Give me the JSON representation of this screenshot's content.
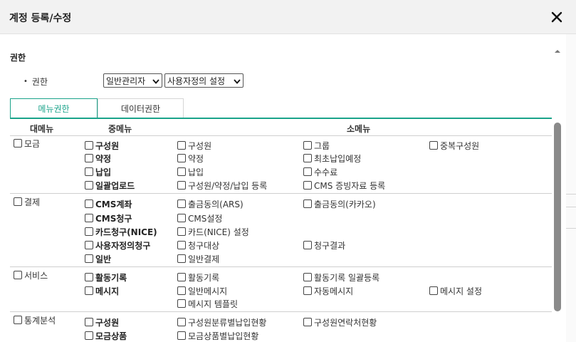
{
  "dialog": {
    "title": "계정 등록/수정"
  },
  "section": {
    "title": "권한"
  },
  "permission": {
    "label": "권한",
    "role_value": "일반관리자",
    "perm_value": "사용자정의 설정"
  },
  "tabs": [
    {
      "label": "메뉴권한",
      "active": true
    },
    {
      "label": "데이터권한",
      "active": false
    }
  ],
  "table": {
    "headers": {
      "main": "대메뉴",
      "mid": "중메뉴",
      "sub": "소메뉴"
    },
    "groups": [
      {
        "main": "모금",
        "rows": [
          {
            "mid": "구성원",
            "subs": [
              "구성원",
              "그룹",
              "중복구성원"
            ]
          },
          {
            "mid": "약정",
            "subs": [
              "약정",
              "최초납입예정"
            ]
          },
          {
            "mid": "납입",
            "subs": [
              "납입",
              "수수료"
            ]
          },
          {
            "mid": "일괄업로드",
            "subs": [
              "구성원/약정/납입 등록",
              "CMS 증빙자료 등록"
            ]
          }
        ]
      },
      {
        "main": "결제",
        "rows": [
          {
            "mid": "CMS계좌",
            "subs": [
              "출금동의(ARS)",
              "출금동의(카카오)"
            ]
          },
          {
            "mid": "CMS청구",
            "subs": [
              "CMS설정"
            ]
          },
          {
            "mid": "카드청구(NICE)",
            "subs": [
              "카드(NICE) 설정"
            ]
          },
          {
            "mid": "사용자정의청구",
            "subs": [
              "청구대상",
              "청구결과"
            ]
          },
          {
            "mid": "일반",
            "subs": [
              "일반결제"
            ]
          }
        ]
      },
      {
        "main": "서비스",
        "rows": [
          {
            "mid": "활동기록",
            "subs": [
              "활동기록",
              "활동기록 일괄등록"
            ]
          },
          {
            "mid": "메시지",
            "subs": [
              "일반메시지",
              "자동메시지",
              "메시지 설정"
            ]
          },
          {
            "mid": "",
            "subs": [
              "메시지 템플릿"
            ]
          }
        ]
      },
      {
        "main": "통계분석",
        "rows": [
          {
            "mid": "구성원",
            "subs": [
              "구성원분류별납입현황",
              "구성원연락처현황"
            ]
          },
          {
            "mid": "모금상품",
            "subs": [
              "모금상품별납입현황"
            ]
          }
        ]
      }
    ]
  }
}
